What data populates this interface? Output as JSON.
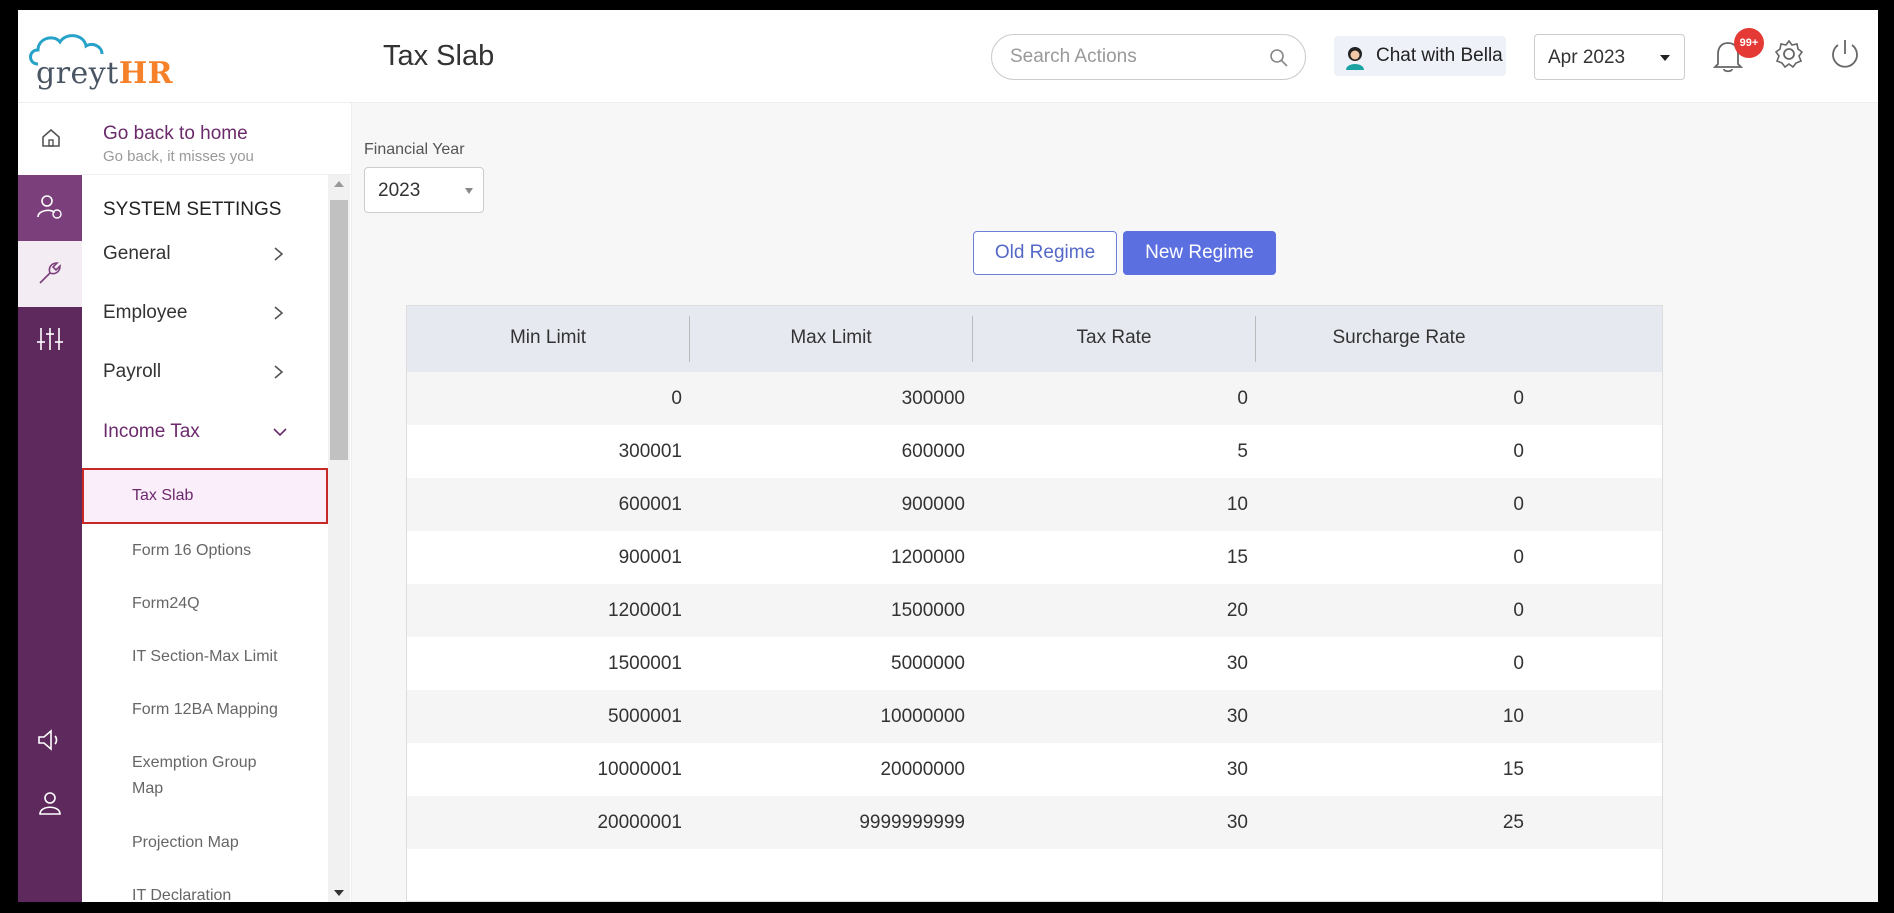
{
  "app": {
    "brand_main": "greyt",
    "brand_accent": "HR",
    "accent_color": "#5e2a5e"
  },
  "header": {
    "title": "Tax Slab",
    "search_placeholder": "Search Actions",
    "chat_label": "Chat with Bella",
    "period": "Apr 2023",
    "notification_badge": "99+"
  },
  "sidebar": {
    "goback_title": "Go back to home",
    "goback_subtitle": "Go back, it misses you",
    "section_title": "SYSTEM SETTINGS",
    "items": [
      {
        "label": "General"
      },
      {
        "label": "Employee"
      },
      {
        "label": "Payroll"
      },
      {
        "label": "Income Tax"
      }
    ],
    "subitems": [
      {
        "label": "Tax Slab",
        "active": true
      },
      {
        "label": "Form 16 Options"
      },
      {
        "label": "Form24Q"
      },
      {
        "label": "IT Section-Max Limit"
      },
      {
        "label": "Form 12BA Mapping"
      },
      {
        "label": "Exemption Group Map"
      },
      {
        "label": "Projection Map"
      },
      {
        "label": "IT Declaration"
      }
    ]
  },
  "main": {
    "fy_label": "Financial Year",
    "fy_value": "2023",
    "regime_old": "Old Regime",
    "regime_new": "New Regime",
    "columns": [
      "Min Limit",
      "Max Limit",
      "Tax Rate",
      "Surcharge Rate"
    ],
    "rows": [
      [
        "0",
        "300000",
        "0",
        "0"
      ],
      [
        "300001",
        "600000",
        "5",
        "0"
      ],
      [
        "600001",
        "900000",
        "10",
        "0"
      ],
      [
        "900001",
        "1200000",
        "15",
        "0"
      ],
      [
        "1200001",
        "1500000",
        "20",
        "0"
      ],
      [
        "1500001",
        "5000000",
        "30",
        "0"
      ],
      [
        "5000001",
        "10000000",
        "30",
        "10"
      ],
      [
        "10000001",
        "20000000",
        "30",
        "15"
      ],
      [
        "20000001",
        "9999999999",
        "30",
        "25"
      ]
    ]
  }
}
